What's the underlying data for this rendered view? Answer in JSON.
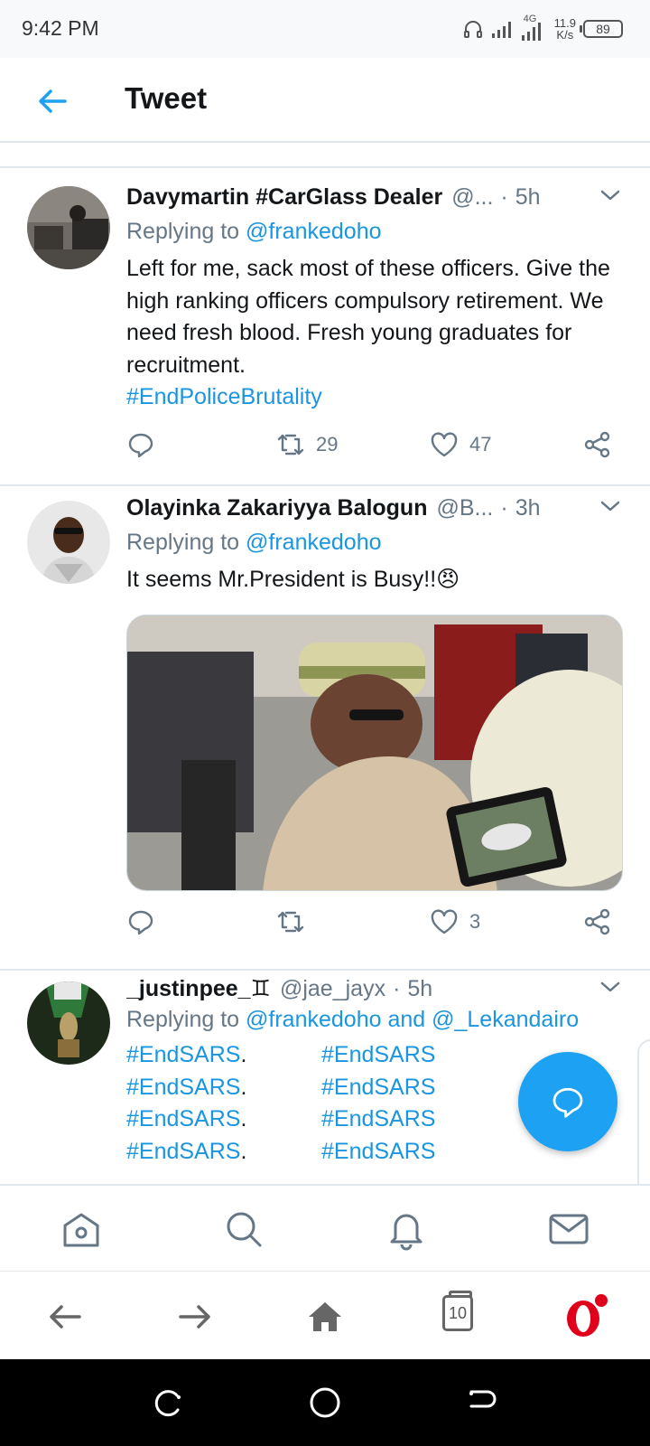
{
  "status_bar": {
    "time": "9:42 PM",
    "network": "4G",
    "net_speed_value": "11.9",
    "net_speed_unit": "K/s",
    "battery": "89"
  },
  "header": {
    "title": "Tweet",
    "back_icon": "arrow-left-icon"
  },
  "tweets": [
    {
      "name": "Davymartin #CarGlass Dealer",
      "handle": "@...",
      "separator": "·",
      "time": "5h",
      "replying_label": "Replying to",
      "replying_to": "@frankedoho",
      "text": "Left for me, sack most of these officers. Give the high ranking officers compulsory retirement. We need fresh blood. Fresh young graduates for recruitment.",
      "hashtag": "#EndPoliceBrutality",
      "retweets": "29",
      "likes": "47"
    },
    {
      "name": "Olayinka Zakariyya Balogun",
      "handle": "@B...",
      "separator": "·",
      "time": "3h",
      "replying_label": "Replying to",
      "replying_to": "@frankedoho",
      "text": "It seems Mr.President is Busy!!",
      "emoji": "😠",
      "retweets": "",
      "likes": "3"
    },
    {
      "name": "_justinpee_♊",
      "handle": "@jae_jayx",
      "separator": "·",
      "time": "5h",
      "replying_label": "Replying to",
      "replying_to": "@frankedoho and @_Lekandairo",
      "hashtags_col1": [
        "#EndSARS",
        "#EndSARS",
        "#EndSARS",
        "#EndSARS"
      ],
      "hashtags_col1_suffix": ".",
      "hashtags_col2": [
        "#EndSARS",
        "#EndSARS",
        "#EndSARS",
        "#EndSARS"
      ]
    }
  ],
  "bottom_nav": {
    "items": [
      "home-icon",
      "search-icon",
      "notifications-icon",
      "messages-icon"
    ]
  },
  "browser_bar": {
    "tab_count": "10",
    "items": [
      "back-icon",
      "forward-icon",
      "home-icon",
      "tabs-icon",
      "opera-icon"
    ]
  },
  "colors": {
    "accent": "#1da1f2",
    "link": "#1b95e0",
    "muted": "#657786",
    "opera_red": "#e0001b"
  }
}
